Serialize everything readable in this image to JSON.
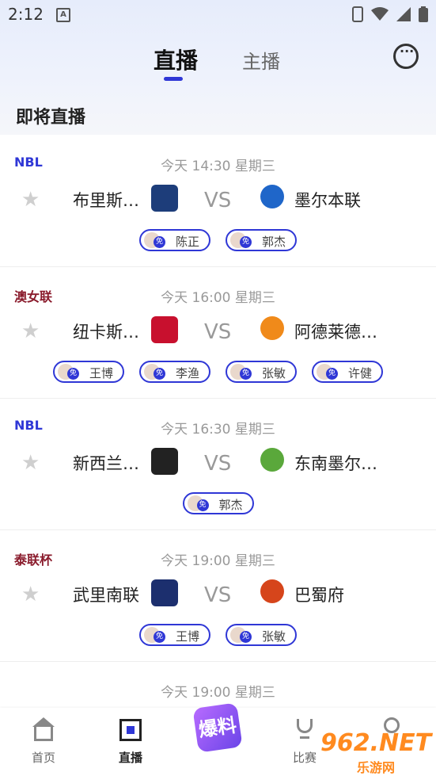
{
  "status_bar": {
    "time": "2:12",
    "app_letter": "A"
  },
  "header": {
    "tab_active": "直播",
    "tab_inactive": "主播",
    "message_icon": "chat-bubble-icon"
  },
  "section_title": "即将直播",
  "matches": [
    {
      "league": "NBL",
      "league_color": "#2f37d6",
      "datetime": "今天 14:30 星期三",
      "home": "布里斯…",
      "away": "墨尔本联",
      "vs": "VS",
      "home_logo_color": "#1d3d7a",
      "away_logo_color": "#1f66c9",
      "anchors": [
        {
          "name": "陈正",
          "badge": "免"
        },
        {
          "name": "郭杰",
          "badge": "免"
        }
      ]
    },
    {
      "league": "澳女联",
      "league_color": "#8a1b2c",
      "datetime": "今天 16:00 星期三",
      "home": "纽卡斯…",
      "away": "阿德莱德…",
      "vs": "VS",
      "home_logo_color": "#c8102e",
      "away_logo_color": "#f08a1a",
      "anchors": [
        {
          "name": "王博",
          "badge": "免"
        },
        {
          "name": "李渔",
          "badge": "免"
        },
        {
          "name": "张敏",
          "badge": "免"
        },
        {
          "name": "许健",
          "badge": "免"
        }
      ]
    },
    {
      "league": "NBL",
      "league_color": "#2f37d6",
      "datetime": "今天 16:30 星期三",
      "home": "新西兰…",
      "away": "东南墨尔…",
      "vs": "VS",
      "home_logo_color": "#222222",
      "away_logo_color": "#5aa83b",
      "home_logo_text": "breakers",
      "anchors": [
        {
          "name": "郭杰",
          "badge": "免"
        }
      ]
    },
    {
      "league": "泰联杯",
      "league_color": "#8a1b2c",
      "datetime": "今天 19:00 星期三",
      "home": "武里南联",
      "away": "巴蜀府",
      "vs": "VS",
      "home_logo_color": "#1c2f6e",
      "away_logo_color": "#d6451b",
      "anchors": [
        {
          "name": "王博",
          "badge": "免"
        },
        {
          "name": "张敏",
          "badge": "免"
        }
      ]
    }
  ],
  "partial_match": {
    "datetime": "今天 19:00 星期三"
  },
  "tabbar": {
    "items": [
      {
        "label": "首页",
        "icon": "home-icon"
      },
      {
        "label": "直播",
        "icon": "live-icon"
      },
      {
        "label": "比赛",
        "icon": "trophy-icon"
      }
    ],
    "center_label": "爆料"
  },
  "watermark": {
    "number": "962.NET",
    "sub": "乐游网"
  }
}
